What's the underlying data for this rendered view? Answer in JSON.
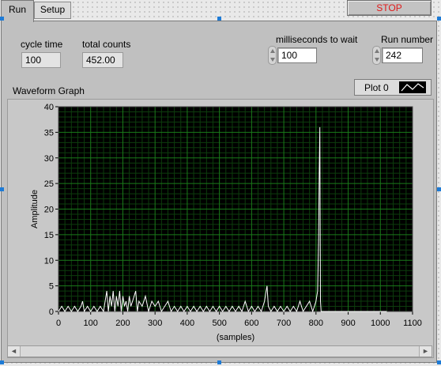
{
  "tabs": [
    {
      "label": "Run"
    },
    {
      "label": "Setup"
    }
  ],
  "stop_button": {
    "label": "STOP",
    "color": "#e01b1b"
  },
  "indicators": {
    "cycle_time": {
      "label": "cycle time",
      "value": "100"
    },
    "total_counts": {
      "label": "total counts",
      "value": "452.00"
    }
  },
  "controls": {
    "ms_to_wait": {
      "label": "milliseconds to wait",
      "value": "100"
    },
    "run_number": {
      "label": "Run number",
      "value": "242"
    }
  },
  "graph": {
    "title": "Waveform Graph",
    "legend": {
      "plot_name": "Plot 0"
    },
    "colors": {
      "plot_bg": "#000000",
      "grid_major": "#1a7a1a",
      "grid_minor": "#0d3d0d",
      "trace": "#ffffff"
    }
  },
  "chart_data": {
    "type": "line",
    "title": "Waveform Graph",
    "xlabel": "(samples)",
    "ylabel": "Amplitude",
    "xlim": [
      0,
      1100
    ],
    "ylim": [
      0,
      40
    ],
    "x_ticks": [
      "0",
      "100",
      "200",
      "300",
      "400",
      "500",
      "600",
      "700",
      "800",
      "900",
      "1000",
      "1100"
    ],
    "y_ticks": [
      "0",
      "5",
      "10",
      "15",
      "20",
      "25",
      "30",
      "35",
      "40"
    ],
    "grid": true,
    "series": [
      {
        "name": "Plot 0",
        "points": [
          [
            0,
            0
          ],
          [
            10,
            1
          ],
          [
            20,
            0
          ],
          [
            30,
            1
          ],
          [
            40,
            0
          ],
          [
            50,
            1
          ],
          [
            60,
            0
          ],
          [
            70,
            1
          ],
          [
            75,
            2
          ],
          [
            80,
            0
          ],
          [
            90,
            1
          ],
          [
            100,
            0
          ],
          [
            110,
            1
          ],
          [
            120,
            0
          ],
          [
            130,
            1
          ],
          [
            140,
            0
          ],
          [
            150,
            4
          ],
          [
            155,
            0
          ],
          [
            160,
            3
          ],
          [
            165,
            1
          ],
          [
            170,
            4
          ],
          [
            175,
            0
          ],
          [
            180,
            3
          ],
          [
            185,
            1
          ],
          [
            190,
            4
          ],
          [
            195,
            0
          ],
          [
            200,
            3
          ],
          [
            205,
            1
          ],
          [
            210,
            2
          ],
          [
            215,
            0
          ],
          [
            220,
            3
          ],
          [
            225,
            1
          ],
          [
            230,
            2
          ],
          [
            240,
            4
          ],
          [
            245,
            0
          ],
          [
            250,
            2
          ],
          [
            260,
            1
          ],
          [
            270,
            3
          ],
          [
            280,
            0
          ],
          [
            290,
            2
          ],
          [
            300,
            1
          ],
          [
            310,
            2
          ],
          [
            320,
            0
          ],
          [
            330,
            1
          ],
          [
            340,
            2
          ],
          [
            350,
            0
          ],
          [
            360,
            1
          ],
          [
            370,
            0
          ],
          [
            380,
            1
          ],
          [
            390,
            0
          ],
          [
            400,
            1
          ],
          [
            410,
            0
          ],
          [
            420,
            1
          ],
          [
            430,
            0
          ],
          [
            440,
            1
          ],
          [
            450,
            0
          ],
          [
            460,
            1
          ],
          [
            470,
            0
          ],
          [
            480,
            1
          ],
          [
            490,
            0
          ],
          [
            500,
            1
          ],
          [
            510,
            0
          ],
          [
            520,
            1
          ],
          [
            530,
            0
          ],
          [
            540,
            1
          ],
          [
            550,
            0
          ],
          [
            560,
            1
          ],
          [
            570,
            0
          ],
          [
            580,
            2
          ],
          [
            590,
            0
          ],
          [
            600,
            1
          ],
          [
            610,
            0
          ],
          [
            620,
            1
          ],
          [
            630,
            0
          ],
          [
            640,
            2
          ],
          [
            645,
            4
          ],
          [
            648,
            5
          ],
          [
            652,
            1
          ],
          [
            660,
            0
          ],
          [
            670,
            1
          ],
          [
            680,
            0
          ],
          [
            690,
            1
          ],
          [
            700,
            0
          ],
          [
            710,
            1
          ],
          [
            720,
            0
          ],
          [
            730,
            1
          ],
          [
            740,
            0
          ],
          [
            750,
            2
          ],
          [
            760,
            0
          ],
          [
            770,
            1
          ],
          [
            780,
            2
          ],
          [
            790,
            0
          ],
          [
            800,
            2
          ],
          [
            805,
            4
          ],
          [
            808,
            14
          ],
          [
            810,
            27
          ],
          [
            812,
            36
          ],
          [
            814,
            2
          ],
          [
            816,
            0
          ],
          [
            830,
            0
          ],
          [
            850,
            0
          ],
          [
            900,
            0
          ],
          [
            950,
            0
          ],
          [
            1000,
            0
          ],
          [
            1020,
            0
          ]
        ]
      }
    ]
  },
  "scroll_arrows": {
    "left": "◄",
    "right": "►"
  }
}
